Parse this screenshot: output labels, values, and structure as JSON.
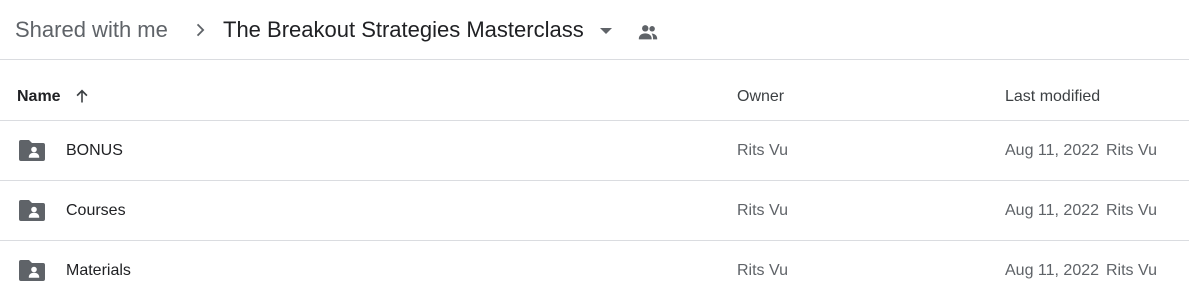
{
  "breadcrumb": {
    "root": "Shared with me",
    "current": "The Breakout Strategies Masterclass",
    "separator_icon": "chevron-right-icon",
    "dropdown_icon": "caret-down-icon",
    "shared_icon": "people-icon"
  },
  "columns": {
    "name": "Name",
    "owner": "Owner",
    "last_modified": "Last modified",
    "sort_icon": "arrow-up-icon"
  },
  "rows": [
    {
      "name": "BONUS",
      "owner": "Rits Vu",
      "modified_date": "Aug 11, 2022",
      "modified_by": "Rits Vu",
      "icon": "shared-folder-icon"
    },
    {
      "name": "Courses",
      "owner": "Rits Vu",
      "modified_date": "Aug 11, 2022",
      "modified_by": "Rits Vu",
      "icon": "shared-folder-icon"
    },
    {
      "name": "Materials",
      "owner": "Rits Vu",
      "modified_date": "Aug 11, 2022",
      "modified_by": "Rits Vu",
      "icon": "shared-folder-icon"
    }
  ],
  "colors": {
    "icon": "#5f6368",
    "divider": "#dadce0",
    "text_primary": "#202124",
    "text_secondary": "#5f6368"
  }
}
